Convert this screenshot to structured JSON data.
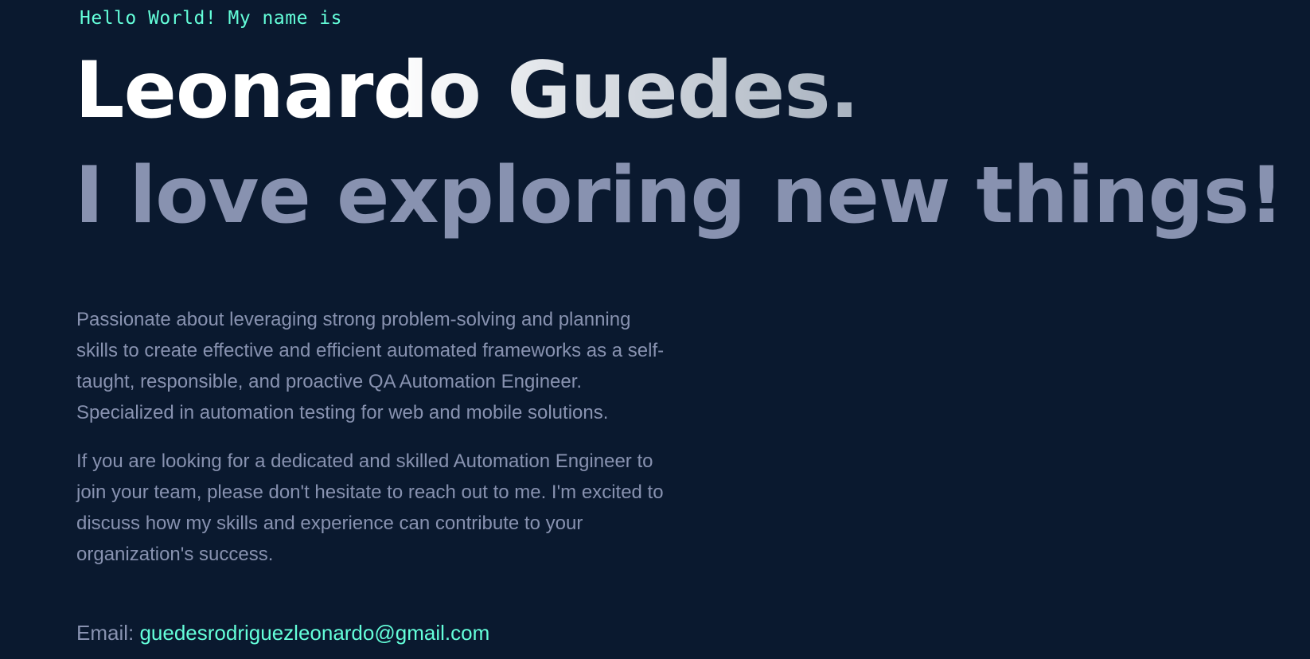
{
  "hero": {
    "greeting": "Hello World! My name is",
    "name": "Leonardo Guedes.",
    "tagline": "I love exploring new things!"
  },
  "bio": {
    "paragraphs": [
      "Passionate about leveraging strong problem-solving and planning skills to create effective and efficient automated frameworks as a self-taught, responsible, and proactive QA Automation Engineer. Specialized in automation testing for web and mobile solutions.",
      "If you are looking for a dedicated and skilled Automation Engineer to join your team, please don't hesitate to reach out to me. I'm excited to discuss how my skills and experience can contribute to your organization's success."
    ]
  },
  "contact": {
    "label": "Email: ",
    "email": "guedesrodriguezleonardo@gmail.com"
  },
  "colors": {
    "background": "#0a192f",
    "accent": "#64ffda",
    "muted": "#8892b0",
    "heading": "#ffffff"
  }
}
